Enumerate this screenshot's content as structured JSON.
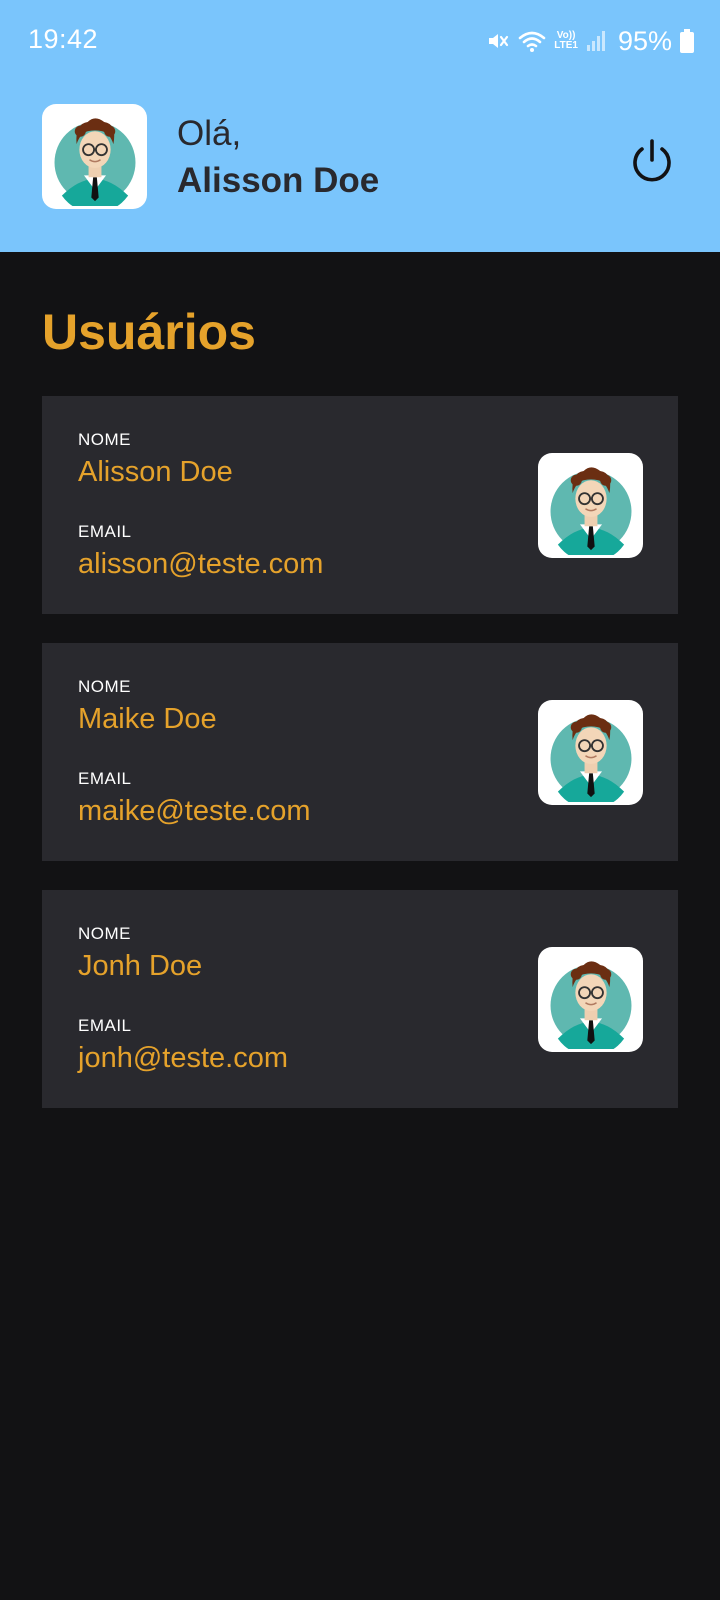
{
  "status_bar": {
    "time": "19:42",
    "network_label_top": "Vo))",
    "network_label_bottom": "LTE1",
    "battery_percent": "95%",
    "icons": [
      "mute-icon",
      "wifi-icon",
      "signal-icon",
      "battery-icon"
    ]
  },
  "header": {
    "greeting": "Olá,",
    "user_name": "Alisson Doe",
    "logout_icon": "power-icon",
    "background_color": "#7ac5fc"
  },
  "main": {
    "title": "Usuários",
    "accent_color": "#e5a22b",
    "users": [
      {
        "name_label": "NOME",
        "name": "Alisson Doe",
        "email_label": "EMAIL",
        "email": "alisson@teste.com"
      },
      {
        "name_label": "NOME",
        "name": "Maike Doe",
        "email_label": "EMAIL",
        "email": "maike@teste.com"
      },
      {
        "name_label": "NOME",
        "name": "Jonh Doe",
        "email_label": "EMAIL",
        "email": "jonh@teste.com"
      }
    ]
  }
}
